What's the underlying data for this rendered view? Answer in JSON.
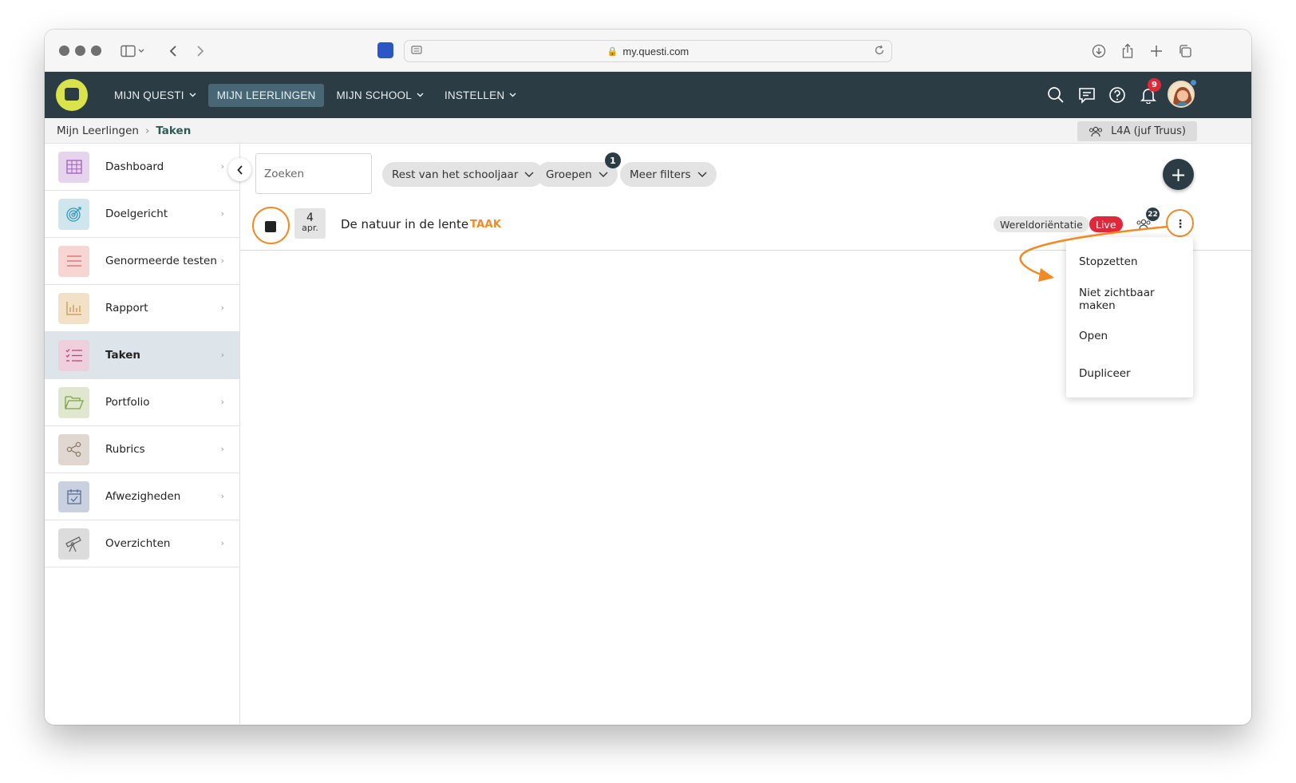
{
  "browser": {
    "url": "my.questi.com"
  },
  "nav": {
    "items": [
      {
        "label": "MIJN QUESTI",
        "dropdown": true,
        "active": false
      },
      {
        "label": "MIJN LEERLINGEN",
        "dropdown": false,
        "active": true
      },
      {
        "label": "MIJN SCHOOL",
        "dropdown": true,
        "active": false
      },
      {
        "label": "INSTELLEN",
        "dropdown": true,
        "active": false
      }
    ],
    "notifications_count": "9"
  },
  "breadcrumb": {
    "parent": "Mijn Leerlingen",
    "current": "Taken"
  },
  "group_selector": {
    "label": "L4A (juf Truus)"
  },
  "sidebar": {
    "items": [
      {
        "label": "Dashboard",
        "icon": "grid-icon",
        "color": "#e6d3ee"
      },
      {
        "label": "Doelgericht",
        "icon": "target-icon",
        "color": "#cfe6ef"
      },
      {
        "label": "Genormeerde testen",
        "icon": "lines-icon",
        "color": "#f6d5d3"
      },
      {
        "label": "Rapport",
        "icon": "bar-chart-icon",
        "color": "#f2e0c7"
      },
      {
        "label": "Taken",
        "icon": "checklist-icon",
        "color": "#efcfdc",
        "active": true
      },
      {
        "label": "Portfolio",
        "icon": "folder-icon",
        "color": "#dfe8cf"
      },
      {
        "label": "Rubrics",
        "icon": "share-icon",
        "color": "#e0d8d0"
      },
      {
        "label": "Afwezigheden",
        "icon": "calendar-check-icon",
        "color": "#c9d0df"
      },
      {
        "label": "Overzichten",
        "icon": "telescope-icon",
        "color": "#dcdcdc"
      }
    ]
  },
  "filters": {
    "search_placeholder": "Zoeken",
    "period": "Rest van het schooljaar",
    "groups": "Groepen",
    "groups_badge": "1",
    "more": "Meer filters"
  },
  "task": {
    "day": "4",
    "month": "apr.",
    "title": "De natuur in de lente",
    "type": "TAAK",
    "subject": "Wereldoriëntatie",
    "status": "Live",
    "participants": "22"
  },
  "context_menu": {
    "items": [
      "Stopzetten",
      "Niet zichtbaar maken",
      "Open",
      "Dupliceer"
    ]
  },
  "colors": {
    "header": "#2b3c45",
    "accent_orange": "#f08a24",
    "live_red": "#e0283b",
    "logo_yellow": "#dbe34a"
  }
}
